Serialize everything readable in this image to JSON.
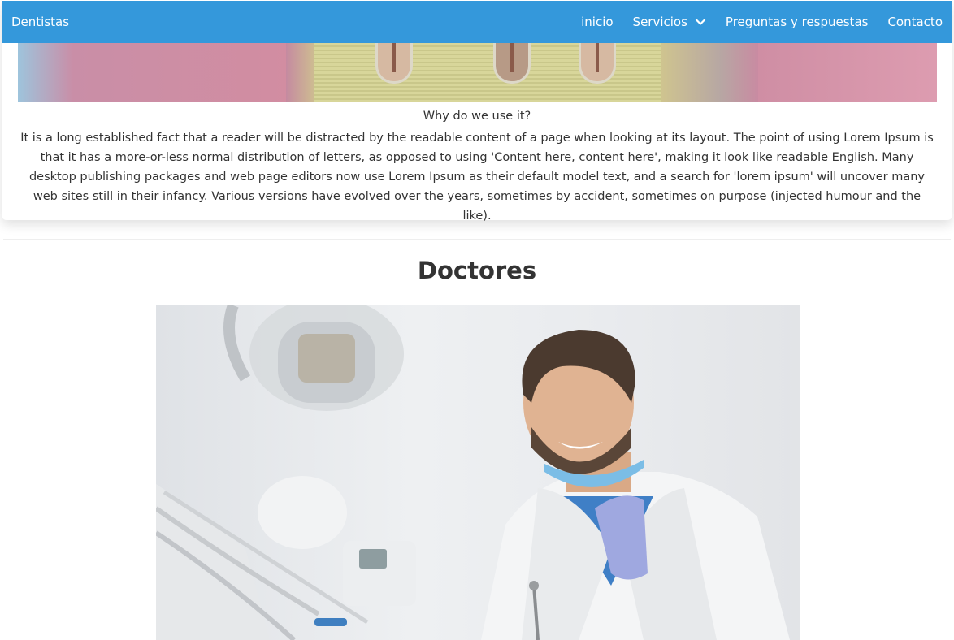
{
  "navbar": {
    "brand": "Dentistas",
    "links": [
      {
        "label": "inicio"
      },
      {
        "label": "Servicios"
      },
      {
        "label": "Preguntas y respuestas"
      },
      {
        "label": "Contacto"
      }
    ]
  },
  "intro": {
    "heading": "Why do we use it?",
    "text": "It is a long established fact that a reader will be distracted by the readable content of a page when looking at its layout. The point of using Lorem Ipsum is that it has a more-or-less normal distribution of letters, as opposed to using 'Content here, content here', making it look like readable English. Many desktop publishing packages and web page editors now use Lorem Ipsum as their default model text, and a search for 'lorem ipsum' will uncover many web sites still in their infancy. Various versions have evolved over the years, sometimes by accident, sometimes on purpose (injected humour and the like)."
  },
  "doctors": {
    "title": "Doctores"
  },
  "colors": {
    "navbar": "#3498db",
    "text": "#333333"
  }
}
